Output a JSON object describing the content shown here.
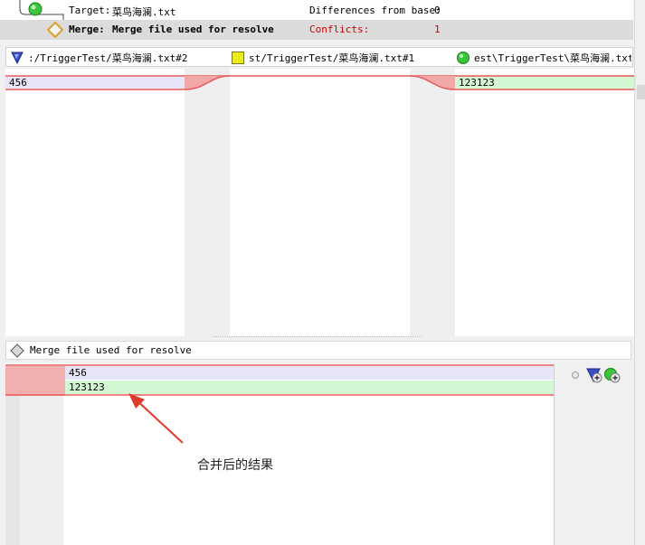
{
  "header": {
    "target_label": "Target:",
    "target_file": "菜鸟海澜.txt",
    "differences_label": "Differences from base:",
    "differences_value": "0",
    "merge_label": "Merge:",
    "merge_desc": "Merge file used for resolve",
    "conflicts_label": "Conflicts:",
    "conflicts_value": "1"
  },
  "paths": {
    "left": ":/TriggerTest/菜鸟海澜.txt#2",
    "middle": "st/TriggerTest/菜鸟海澜.txt#1",
    "right": "est\\TriggerTest\\菜鸟海澜.txt"
  },
  "diff": {
    "left_line": "456",
    "middle_line": "",
    "right_line": "123123"
  },
  "merge": {
    "title": "Merge file used for resolve",
    "lines": [
      "456",
      "123123"
    ]
  },
  "annotation": {
    "text": "合并后的结果"
  },
  "colors": {
    "conflict_red": "#e85a5a",
    "left_bg": "#e6e6f8",
    "right_bg": "#d4f7d4",
    "conflicts_text": "#cc0000"
  }
}
